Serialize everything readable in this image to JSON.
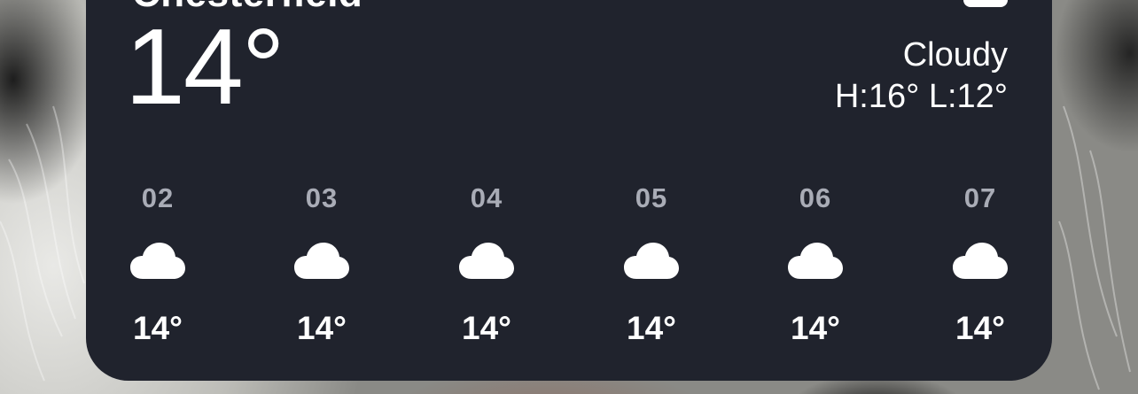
{
  "widget": {
    "location": "Chesterfield",
    "current_temp": "14°",
    "condition": "Cloudy",
    "high_low": "H:16° L:12°",
    "location_icon": "location-arrow-icon"
  },
  "hourly": [
    {
      "time": "02",
      "icon": "cloud-icon",
      "temp": "14°"
    },
    {
      "time": "03",
      "icon": "cloud-icon",
      "temp": "14°"
    },
    {
      "time": "04",
      "icon": "cloud-icon",
      "temp": "14°"
    },
    {
      "time": "05",
      "icon": "cloud-icon",
      "temp": "14°"
    },
    {
      "time": "06",
      "icon": "cloud-icon",
      "temp": "14°"
    },
    {
      "time": "07",
      "icon": "cloud-icon",
      "temp": "14°"
    }
  ],
  "colors": {
    "widget_background": "#20232d",
    "text_primary": "#ffffff",
    "text_secondary": "#a9acb6"
  }
}
